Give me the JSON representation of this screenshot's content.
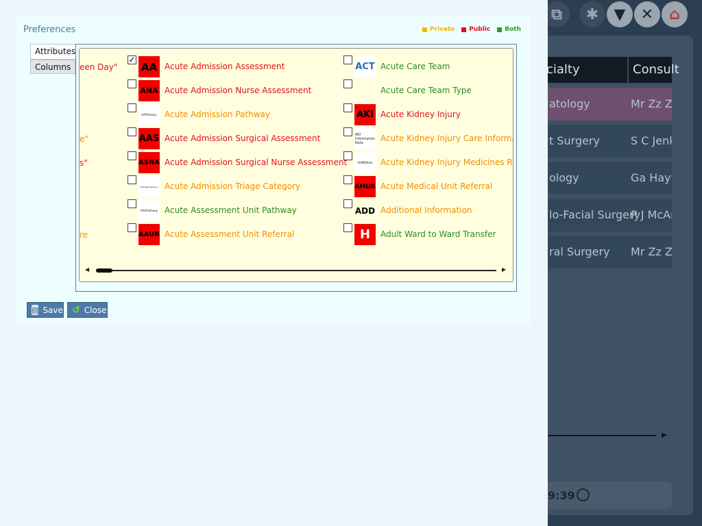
{
  "background": {
    "header": [
      "cialty",
      "Consult"
    ],
    "rows": [
      {
        "specialty": "atology",
        "consultant": "Mr Zz Zz",
        "highlighted": true
      },
      {
        "specialty": "t Surgery",
        "consultant": "S C Jenk"
      },
      {
        "specialty": "ology",
        "consultant": "Ga Hayw"
      },
      {
        "specialty": "lo-Facial Surgery",
        "consultant": "P J McAr"
      },
      {
        "specialty": "ral Surgery",
        "consultant": "Mr Zz Zz"
      }
    ],
    "footer_time": "9:39"
  },
  "dialog": {
    "title": "Preferences",
    "legend": [
      {
        "label": "Private",
        "color": "#f5b800"
      },
      {
        "label": "Public",
        "color": "#e0101a"
      },
      {
        "label": "Both",
        "color": "#2e9a2e"
      }
    ],
    "tabs": {
      "attributes": "Attributes",
      "columns": "Columns"
    },
    "partial_left": [
      "een Day\"",
      "e\"",
      "s\"",
      "re"
    ],
    "column1": [
      {
        "icon": "AA",
        "label": "Acute Admission Assessment",
        "checked": true,
        "category": "public"
      },
      {
        "icon": "ANA",
        "label": "Acute Admission Nurse Assessment",
        "checked": false,
        "category": "public"
      },
      {
        "icon": "AAPathway",
        "label": "Acute Admission Pathway",
        "checked": false,
        "category": "private"
      },
      {
        "icon": "AAS",
        "label": "Acute Admission Surgical  Assessment",
        "checked": false,
        "category": "public"
      },
      {
        "icon": "ASNA",
        "label": "Acute Admission Surgical Nurse Assessment",
        "checked": false,
        "category": "public"
      },
      {
        "icon": "AATriageCategory",
        "label": "Acute Admission Triage Category",
        "checked": false,
        "category": "private"
      },
      {
        "icon": "AAUPathway",
        "label": "Acute Assessment Unit Pathway",
        "checked": false,
        "category": "both"
      },
      {
        "icon": "AAUR",
        "label": "Acute Assessment Unit Referral",
        "checked": false,
        "category": "private"
      }
    ],
    "column2": [
      {
        "icon": "ACT",
        "label": "Acute Care Team",
        "checked": false,
        "category": "both"
      },
      {
        "icon": "",
        "label": "Acute Care Team Type",
        "checked": false,
        "category": "both"
      },
      {
        "icon": "AKI",
        "label": "Acute Kidney Injury",
        "checked": false,
        "category": "public"
      },
      {
        "icon": "AKI Information Note",
        "label": "Acute Kidney Injury Care Informatio",
        "checked": false,
        "category": "private"
      },
      {
        "icon": "AKIMRNote",
        "label": "Acute Kidney Injury Medicines Revie",
        "checked": false,
        "category": "private"
      },
      {
        "icon": "AMUR",
        "label": "Acute Medical Unit Referral",
        "checked": false,
        "category": "private"
      },
      {
        "icon": "ADD",
        "label": "Additional Information",
        "checked": false,
        "category": "private"
      },
      {
        "icon": "H",
        "label": "Adult Ward to Ward Transfer",
        "checked": false,
        "category": "both"
      }
    ],
    "buttons": {
      "save": "Save",
      "close": "Close"
    }
  },
  "colors": {
    "private": "#f08c00",
    "public": "#e0101a",
    "both": "#2e8a22"
  }
}
